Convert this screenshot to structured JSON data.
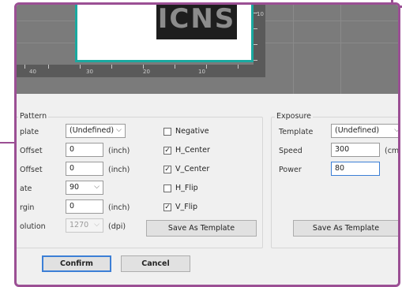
{
  "preview": {
    "image_text": "ICNS",
    "ruler_labels": [
      "40",
      "30",
      "20",
      "10"
    ],
    "ruler_v_label": "10"
  },
  "pattern": {
    "title": "Pattern",
    "template_label": "plate",
    "template_value": "(Undefined)",
    "x_offset_label": "Offset",
    "x_offset_value": "0",
    "x_unit": "(inch)",
    "y_offset_label": "Offset",
    "y_offset_value": "0",
    "y_unit": "(inch)",
    "rotate_label": "ate",
    "rotate_value": "90",
    "margin_label": "rgin",
    "margin_value": "0",
    "margin_unit": "(inch)",
    "resolution_label": "olution",
    "resolution_value": "1270",
    "resolution_unit": "(dpi)",
    "checkboxes": [
      {
        "label": "Negative",
        "checked": false,
        "mark": ""
      },
      {
        "label": "H_Center",
        "checked": true,
        "mark": "✓"
      },
      {
        "label": "V_Center",
        "checked": true,
        "mark": "✓"
      },
      {
        "label": "H_Flip",
        "checked": false,
        "mark": ""
      },
      {
        "label": "V_Flip",
        "checked": true,
        "mark": "✓"
      }
    ],
    "save_template_label": "Save As Template"
  },
  "exposure": {
    "title": "Exposure",
    "template_label": "Template",
    "template_value": "(Undefined)",
    "speed_label": "Speed",
    "speed_value": "300",
    "speed_unit": "(cm",
    "power_label": "Power",
    "power_value": "80",
    "save_template_label": "Save As Template"
  },
  "footer": {
    "confirm_label": "Confirm",
    "cancel_label": "Cancel"
  },
  "colors": {
    "frame": "#9b4f94",
    "paper_border": "#1aa9a0",
    "focus": "#3c7fd6"
  }
}
